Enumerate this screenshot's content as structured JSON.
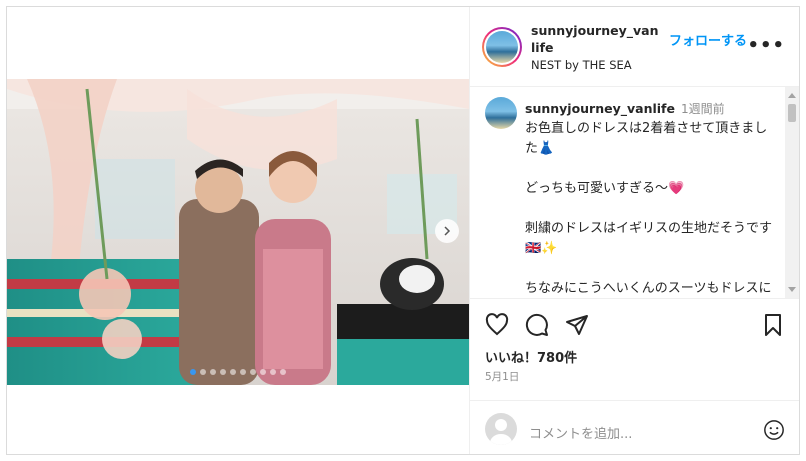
{
  "post": {
    "username": "sunnyjourney_vanlife",
    "follow_label": "フォローする",
    "location": "NEST by THE SEA",
    "more_label": "•••"
  },
  "caption": {
    "username": "sunnyjourney_vanlife",
    "time": "1週間前",
    "lines": [
      "お色直しのドレスは2着着させて頂きました👗",
      "",
      "どっちも可愛いすぎる〜💗",
      "",
      "刺繍のドレスはイギリスの生地だそうです🇬🇧✨",
      "",
      "ちなみにこうへいくんのスーツもドレスに合わせて"
    ]
  },
  "actions": {
    "like_icon": "heart-icon",
    "comment_icon": "comment-icon",
    "share_icon": "send-icon",
    "save_icon": "bookmark-icon"
  },
  "likes": "いいね！780件",
  "date": "5月1日",
  "comment": {
    "placeholder": "コメントを追加..."
  },
  "carousel": {
    "slide_count": 10,
    "active_index": 0
  },
  "colors": {
    "accent": "#0095f6",
    "border": "#dbdbdb",
    "muted": "#8e8e8e"
  }
}
